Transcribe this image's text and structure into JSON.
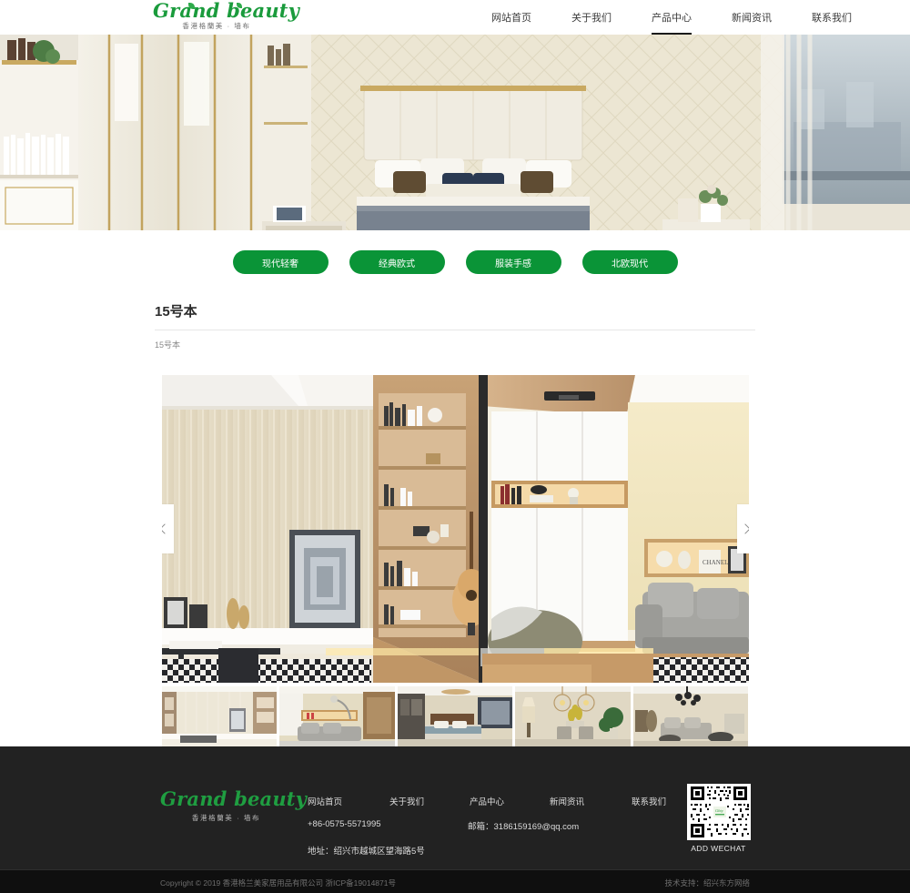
{
  "brand": {
    "name": "Grand beauty",
    "subtitle": "香港格蘭美 · 墙布"
  },
  "nav": {
    "items": [
      {
        "label": "网站首页",
        "active": false
      },
      {
        "label": "关于我们",
        "active": false
      },
      {
        "label": "产品中心",
        "active": true
      },
      {
        "label": "新闻资讯",
        "active": false
      },
      {
        "label": "联系我们",
        "active": false
      }
    ]
  },
  "categories": [
    {
      "label": "现代轻奢"
    },
    {
      "label": "经典欧式"
    },
    {
      "label": "服装手感"
    },
    {
      "label": "北欧现代"
    }
  ],
  "page": {
    "title": "15号本",
    "breadcrumb": "15号本"
  },
  "gallery": {
    "prev_label": "‹",
    "next_label": "›",
    "thumbs": [
      {
        "alt": "条纹墙布客厅"
      },
      {
        "alt": "现代客厅沙发"
      },
      {
        "alt": "卧室床品"
      },
      {
        "alt": "餐厅吊灯"
      },
      {
        "alt": "欧式客厅"
      }
    ]
  },
  "footer": {
    "nav": [
      "网站首页",
      "关于我们",
      "产品中心",
      "新闻资讯",
      "联系我们"
    ],
    "phone": "+86-0575-5571995",
    "address": "地址：绍兴市越城区望海路5号",
    "email": "邮箱：3186159169@qq.com",
    "qr_label": "ADD WECHAT",
    "copyright": "Copyright © 2019 香港格兰美家居用品有限公司 浙ICP备19014871号",
    "tech": "技术支持：绍兴东方网络"
  },
  "colors": {
    "brand_green": "#0a9437",
    "logo_green": "#1a9b3c",
    "footer_bg": "#222222",
    "copyright_bg": "#0f0f0f"
  }
}
